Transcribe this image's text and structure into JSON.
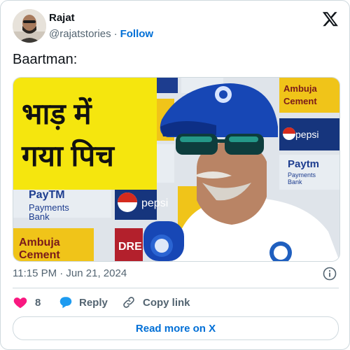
{
  "author": {
    "name": "Rajat",
    "handle": "@rajatstories",
    "separator": "·",
    "follow_label": "Follow"
  },
  "tweet": {
    "text": "Baartman:",
    "timestamp": "11:15 PM · Jun 21, 2024"
  },
  "media": {
    "caption_line1": "भाड़ में",
    "caption_line2": "गया पिच",
    "sponsor_boards": [
      "Ambuja Cement",
      "pepsi",
      "Paytm Payments Bank",
      "DREAM11"
    ]
  },
  "actions": {
    "likes_count": "8",
    "reply_label": "Reply",
    "copy_link_label": "Copy link"
  },
  "footer": {
    "read_more_label": "Read more on X"
  },
  "colors": {
    "link_blue": "#006fd6",
    "like_red": "#f91880",
    "reply_blue": "#1d9bf0",
    "caption_yellow": "#f5e60e"
  }
}
